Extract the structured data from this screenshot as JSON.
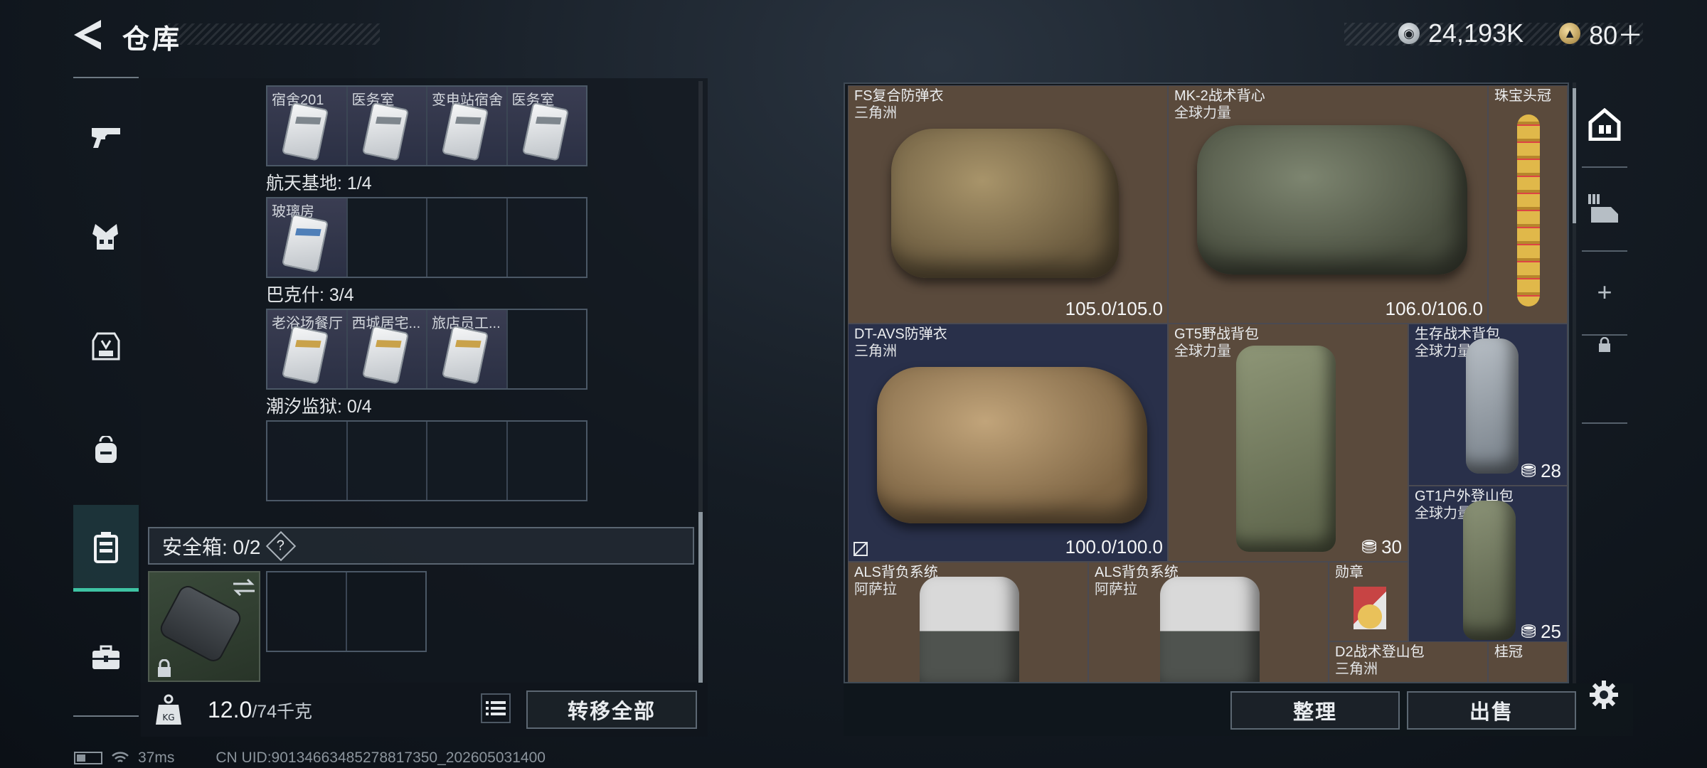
{
  "header": {
    "title": "仓库",
    "currency1": "24,193K",
    "currency2": "80＋"
  },
  "sidebar": {
    "items": [
      {
        "icon": "pistol-icon"
      },
      {
        "icon": "armor-vest-icon"
      },
      {
        "icon": "backpack-icon"
      },
      {
        "icon": "bag-icon"
      },
      {
        "icon": "case-icon",
        "active": true
      },
      {
        "icon": "toolbox-icon"
      }
    ]
  },
  "keys": {
    "sections": [
      {
        "label": "",
        "slots": [
          {
            "label": "宿舍201",
            "card": "white"
          },
          {
            "label": "医务室",
            "card": "white"
          },
          {
            "label": "变电站宿舍",
            "card": "white"
          },
          {
            "label": "医务室",
            "card": "white"
          }
        ]
      },
      {
        "label": "航天基地: 1/4",
        "slots": [
          {
            "label": "玻璃房",
            "card": "blue"
          },
          {
            "label": "",
            "card": ""
          },
          {
            "label": "",
            "card": ""
          },
          {
            "label": "",
            "card": ""
          }
        ]
      },
      {
        "label": "巴克什: 3/4",
        "slots": [
          {
            "label": "老浴场餐厅",
            "card": "gold"
          },
          {
            "label": "西城居宅...",
            "card": "gold"
          },
          {
            "label": "旅店员工...",
            "card": "gold"
          },
          {
            "label": "",
            "card": ""
          }
        ]
      },
      {
        "label": "潮汐监狱: 0/4",
        "slots": [
          {
            "label": "",
            "card": ""
          },
          {
            "label": "",
            "card": ""
          },
          {
            "label": "",
            "card": ""
          },
          {
            "label": "",
            "card": ""
          }
        ]
      }
    ]
  },
  "safebox": {
    "label": "安全箱: 0/2",
    "help": "?"
  },
  "footer": {
    "weight": "12.0",
    "weight_max": "/74千克",
    "transfer_all": "转移全部",
    "latency": "37ms",
    "uid": "CN UID:9013466348527881735​0_202605031400"
  },
  "inventory": {
    "items": [
      {
        "name": "FS复合防弹衣",
        "sub": "三角洲",
        "durability": "105.0/105.0",
        "cap": ""
      },
      {
        "name": "MK-2战术背心",
        "sub": "全球力量",
        "durability": "106.0/106.0",
        "cap": ""
      },
      {
        "name": "珠宝头冠",
        "sub": "",
        "durability": "",
        "cap": ""
      },
      {
        "name": "DT-AVS防弹衣",
        "sub": "三角洲",
        "durability": "100.0/100.0",
        "cap": ""
      },
      {
        "name": "GT5野战背包",
        "sub": "全球力量",
        "durability": "",
        "cap": "30"
      },
      {
        "name": "生存战术背包",
        "sub": "全球力量",
        "durability": "",
        "cap": "28"
      },
      {
        "name": "GT1户外登山包",
        "sub": "全球力量",
        "durability": "",
        "cap": "25"
      },
      {
        "name": "ALS背负系统",
        "sub": "阿萨拉",
        "durability": "",
        "cap": ""
      },
      {
        "name": "ALS背负系统",
        "sub": "阿萨拉",
        "durability": "",
        "cap": ""
      },
      {
        "name": "勋章",
        "sub": "",
        "durability": "",
        "cap": ""
      },
      {
        "name": "D2战术登山包",
        "sub": "三角洲",
        "durability": "",
        "cap": ""
      },
      {
        "name": "桂冠",
        "sub": "",
        "durability": "",
        "cap": ""
      }
    ]
  },
  "actions": {
    "sort": "整理",
    "sell": "出售"
  },
  "colors": {
    "accent": "#3ec3a3",
    "brown_slot": "#5a4a3c",
    "blue_slot": "#29304a"
  }
}
